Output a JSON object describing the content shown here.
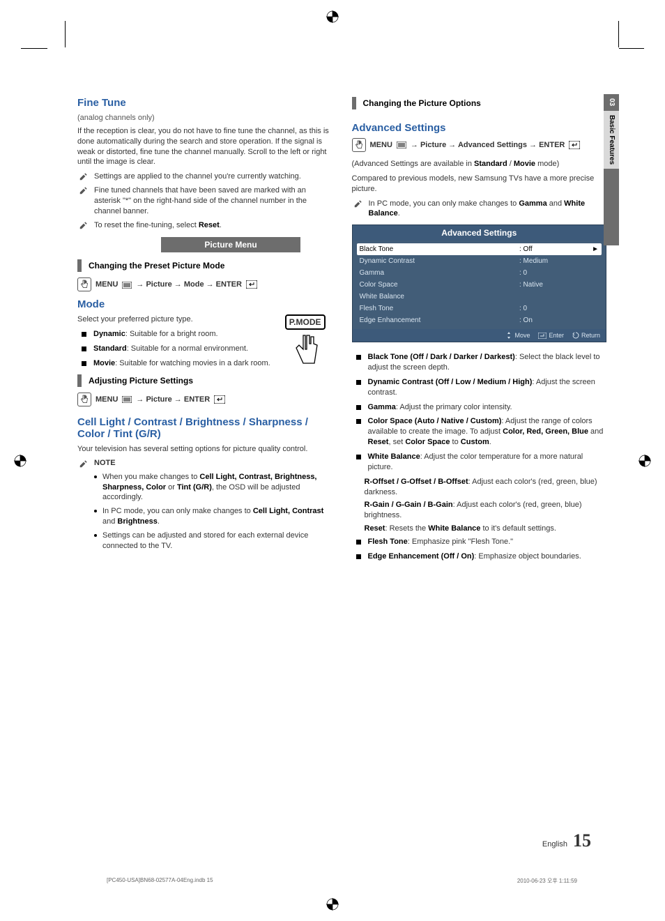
{
  "sideTab": {
    "num": "03",
    "label": "Basic Features"
  },
  "left": {
    "fineTune": {
      "title": "Fine Tune",
      "sub": "(analog channels only)",
      "body": "If the reception is clear, you do not have to fine tune the channel, as this is done automatically during the search and store operation. If the signal is weak or distorted, fine tune the channel manually. Scroll to the left or right until the image is clear.",
      "n1": "Settings are applied to the channel you're currently watching.",
      "n2": "Fine tuned channels that have been saved are marked with an asterisk \"*\" on the right-hand side of the channel number in the channel banner.",
      "n3_a": "To reset the fine-tuning, select ",
      "n3_b": "Reset",
      "n3_c": "."
    },
    "band": "Picture Menu",
    "preset": {
      "title": "Changing the Preset Picture Mode",
      "path_menu": "MENU",
      "path_rest": " → Picture → Mode → ENTER"
    },
    "mode": {
      "title": "Mode",
      "sub": "Select your preferred picture type.",
      "b1a": "Dynamic",
      "b1b": ": Suitable for a bright room.",
      "b2a": "Standard",
      "b2b": ": Suitable for a normal environment.",
      "b3a": "Movie",
      "b3b": ": Suitable for watching movies in a dark room.",
      "pmode": "P.MODE"
    },
    "adjust": {
      "title": "Adjusting Picture Settings",
      "path_menu": "MENU",
      "path_rest": " → Picture → ENTER"
    },
    "cell": {
      "title": "Cell Light / Contrast / Brightness / Sharpness / Color / Tint (G/R)",
      "body": "Your television has several setting options for picture quality control.",
      "noteLabel": "NOTE",
      "s1a": "When you make changes to ",
      "s1b": "Cell Light, Contrast, Brightness, Sharpness, Color",
      "s1c": " or ",
      "s1d": "Tint (G/R)",
      "s1e": ", the OSD will be adjusted accordingly.",
      "s2a": "In PC mode, you can only make changes to ",
      "s2b": "Cell Light, Contrast",
      "s2c": " and ",
      "s2d": "Brightness",
      "s2e": ".",
      "s3": "Settings can be adjusted and stored for each external device connected to the TV."
    }
  },
  "right": {
    "changing": {
      "title": "Changing the Picture Options"
    },
    "adv": {
      "title": "Advanced Settings",
      "path_menu": "MENU",
      "path_rest": " → Picture → Advanced Settings → ENTER",
      "p1a": "(Advanced Settings are available in ",
      "p1b": "Standard",
      "p1c": " / ",
      "p1d": "Movie",
      "p1e": " mode)",
      "p2": "Compared to previous models, new Samsung TVs have a more precise picture.",
      "n1a": "In PC mode, you can only make changes to ",
      "n1b": "Gamma",
      "n1c": " and ",
      "n1d": "White Balance",
      "n1e": "."
    },
    "osd": {
      "title": "Advanced Settings",
      "rows": [
        {
          "name": "Black Tone",
          "val": ": Off",
          "sel": true
        },
        {
          "name": "Dynamic Contrast",
          "val": ": Medium"
        },
        {
          "name": "Gamma",
          "val": ": 0"
        },
        {
          "name": "Color Space",
          "val": ": Native"
        },
        {
          "name": "White Balance",
          "val": ""
        },
        {
          "name": "Flesh Tone",
          "val": ": 0"
        },
        {
          "name": "Edge Enhancement",
          "val": ": On"
        }
      ],
      "foot": {
        "move": "Move",
        "enter": "Enter",
        "ret": "Return"
      }
    },
    "list": {
      "b1a": "Black Tone (Off / Dark / Darker / Darkest)",
      "b1b": ": Select the black level to adjust the screen depth.",
      "b2a": "Dynamic Contrast (Off / Low / Medium / High)",
      "b2b": ": Adjust the screen contrast.",
      "b3a": "Gamma",
      "b3b": ": Adjust the primary color intensity.",
      "b4a": "Color Space (Auto / Native / Custom)",
      "b4b": ": Adjust the range of colors available to create the image. To adjust ",
      "b4c": "Color, Red, Green, Blue",
      "b4d": " and ",
      "b4e": "Reset",
      "b4f": ", set ",
      "b4g": "Color Space",
      "b4h": " to ",
      "b4i": "Custom",
      "b4j": ".",
      "b5a": "White Balance",
      "b5b": ": Adjust the color temperature for a more natural picture.",
      "wb1a": "R-Offset / G-Offset / B-Offset",
      "wb1b": ": Adjust each color's (red, green, blue) darkness.",
      "wb2a": "R-Gain / G-Gain / B-Gain",
      "wb2b": ": Adjust each color's (red, green, blue) brightness.",
      "wb3a": "Reset",
      "wb3b": ": Resets the ",
      "wb3c": "White Balance",
      "wb3d": " to it's default settings.",
      "b6a": "Flesh Tone",
      "b6b": ": Emphasize pink \"Flesh Tone.\"",
      "b7a": "Edge Enhancement (Off / On)",
      "b7b": ": Emphasize object boundaries."
    }
  },
  "footer": {
    "eng": "English",
    "num": "15"
  },
  "imprint": {
    "file": "[PC450-USA]BN68-02577A-04Eng.indb   15",
    "date": "2010-06-23   오후 1:11:59"
  }
}
